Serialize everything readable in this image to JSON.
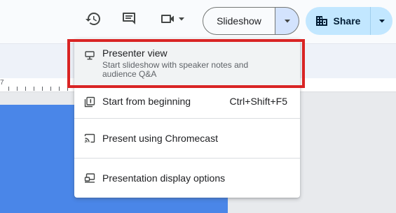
{
  "toolbar": {
    "history_icon": "history-icon",
    "comment_icon": "comment-icon",
    "meet_icon": "video-camera-icon",
    "slideshow_label": "Slideshow",
    "share_label": "Share",
    "share_icon": "building-icon"
  },
  "ruler": {
    "number": "7"
  },
  "menu": {
    "items": [
      {
        "label": "Presenter view",
        "description": "Start slideshow with speaker notes and audience Q&A",
        "icon": "presenter-view-icon",
        "shortcut": ""
      },
      {
        "label": "Start from beginning",
        "description": "",
        "icon": "start-from-beginning-icon",
        "shortcut": "Ctrl+Shift+F5"
      },
      {
        "label": "Present using Chromecast",
        "description": "",
        "icon": "cast-icon",
        "shortcut": ""
      },
      {
        "label": "Presentation display options",
        "description": "",
        "icon": "display-options-icon",
        "shortcut": ""
      }
    ]
  },
  "colors": {
    "slide": "#4a86e8",
    "highlight": "#d92424",
    "share_bg": "#c2e7ff"
  }
}
